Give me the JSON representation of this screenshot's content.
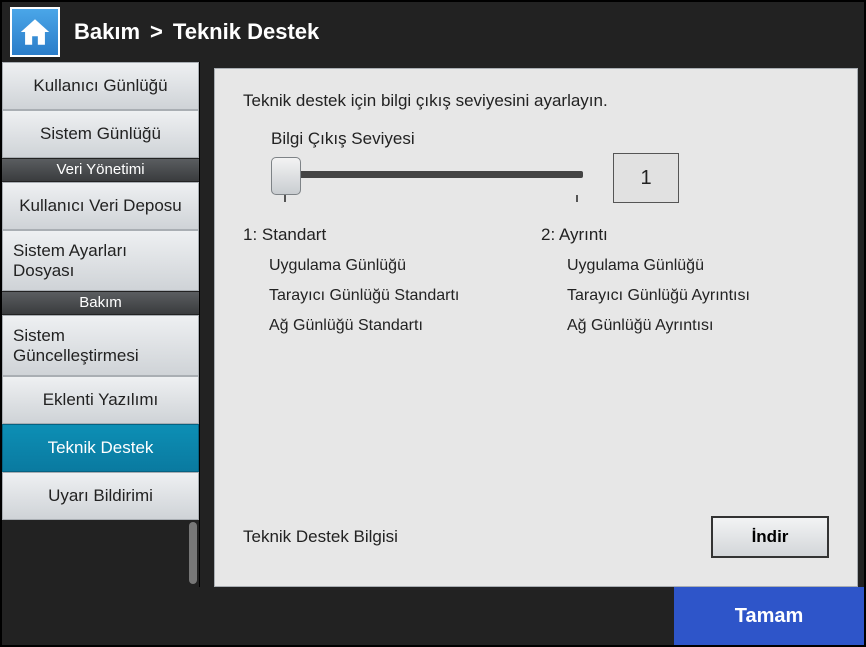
{
  "header": {
    "crumb1": "Bakım",
    "sep": ">",
    "crumb2": "Teknik Destek"
  },
  "sidebar": {
    "items": [
      {
        "label": "Kullanıcı Günlüğü",
        "align": "center"
      },
      {
        "label": "Sistem Günlüğü",
        "align": "center"
      }
    ],
    "group1": "Veri Yönetimi",
    "items2": [
      {
        "label": "Kullanıcı Veri Deposu",
        "align": "center"
      },
      {
        "label": "Sistem Ayarları Dosyası",
        "align": "left"
      }
    ],
    "group2": "Bakım",
    "items3": [
      {
        "label": "Sistem Güncelleştirmesi",
        "align": "left"
      },
      {
        "label": "Eklenti Yazılımı",
        "align": "center"
      },
      {
        "label": "Teknik Destek",
        "align": "center",
        "active": true
      },
      {
        "label": "Uyarı Bildirimi",
        "align": "center"
      }
    ]
  },
  "panel": {
    "desc": "Teknik destek için bilgi çıkış seviyesini ayarlayın.",
    "slider_label": "Bilgi Çıkış Seviyesi",
    "value": "1",
    "level1": {
      "head": "1: Standart",
      "items": [
        "Uygulama Günlüğü",
        "Tarayıcı Günlüğü Standartı",
        "Ağ Günlüğü Standartı"
      ]
    },
    "level2": {
      "head": "2: Ayrıntı",
      "items": [
        "Uygulama Günlüğü",
        "Tarayıcı Günlüğü Ayrıntısı",
        "Ağ Günlüğü Ayrıntısı"
      ]
    },
    "download_label": "Teknik Destek Bilgisi",
    "download_button": "İndir"
  },
  "footer": {
    "ok": "Tamam"
  }
}
